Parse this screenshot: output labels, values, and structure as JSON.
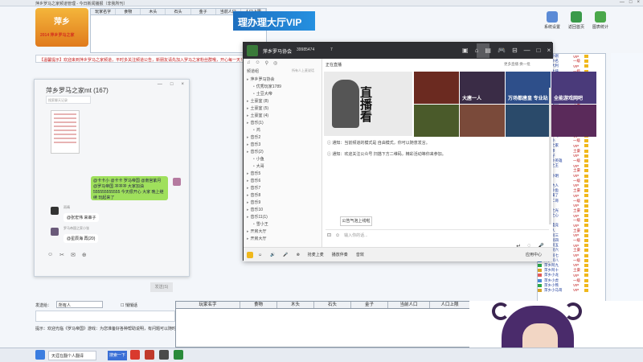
{
  "bg_window": {
    "title": "萍乡罗马之家频道管理 - 今日新闻播报（非我所刊）",
    "controls": [
      "—",
      "□",
      "×"
    ],
    "logo_text": "萍乡",
    "logo_sub": "2014 萍乡罗马之家",
    "vip_banner": "理办理大厅VIP",
    "tools": [
      {
        "label": "系统设置",
        "color": "#5b8bd6"
      },
      {
        "label": "返回首页",
        "color": "#3a9a4a"
      },
      {
        "label": "图表统计",
        "color": "#4aa84a"
      }
    ],
    "announcement": "【温馨提示】欢迎来到萍乡罗马之家频道，平时多关注频道公告，新朋友请先加入罗马之家粉丝群哦，开心每一天！",
    "top_table_headers": [
      "玩家名字",
      "食物",
      "木头",
      "石头",
      "金子",
      "当前人口",
      "人口上限"
    ]
  },
  "chat": {
    "title": "萍乡罗马之家mt (167)",
    "controls": [
      "—",
      "□",
      "×"
    ],
    "search_placeholder": "搜索聊天记录",
    "green_msg": "@卡卡小 @卡卡 罗马帝国 @南宫紫月 @罗马帝国 冲冲冲 大家加油 555555555555 今天很开心 大家 晚上继续 玩起来了",
    "user1_name": "雨晴",
    "user1_msg": "@张宏伟 来串子",
    "user2_name": "罗马帝国之家小张",
    "user2_msg": "@星辰海 再(20)",
    "toolbar": [
      "☺",
      "✂",
      "✉",
      "⊕"
    ],
    "send_label": "发送(S)"
  },
  "yy": {
    "name": "萍乡罗马协会",
    "id": "39985474",
    "fans": "7",
    "head_icons": [
      "▣",
      "⌂",
      "▤",
      "🎮",
      "⊟",
      "—",
      "□",
      "×"
    ],
    "channel_label": "频道组",
    "channel_right": "所有人上麦说话",
    "tabs_top": [
      "♫",
      "☺",
      "⚲",
      "◎"
    ],
    "channels": [
      {
        "label": "萍乡罗马协会",
        "level": 0
      },
      {
        "label": "优秀玩家1789",
        "level": 1
      },
      {
        "label": "土豆大帝",
        "level": 1
      },
      {
        "label": "土豪室 (8)",
        "level": 0
      },
      {
        "label": "土豪室 (5)",
        "level": 0
      },
      {
        "label": "土豪室 (4)",
        "level": 0
      },
      {
        "label": "音乐(1)",
        "level": 0
      },
      {
        "label": "鸿",
        "level": 1
      },
      {
        "label": "音乐2",
        "level": 0
      },
      {
        "label": "音乐3",
        "level": 0
      },
      {
        "label": "音乐(2)",
        "level": 0
      },
      {
        "label": "小鱼",
        "level": 1
      },
      {
        "label": "大哥",
        "level": 1
      },
      {
        "label": "音乐5",
        "level": 0
      },
      {
        "label": "音乐6",
        "level": 0
      },
      {
        "label": "音乐7",
        "level": 0
      },
      {
        "label": "音乐8",
        "level": 0
      },
      {
        "label": "音乐9",
        "level": 0
      },
      {
        "label": "音乐10",
        "level": 0
      },
      {
        "label": "音乐11(1)",
        "level": 0
      },
      {
        "label": "雪小王",
        "level": 1
      },
      {
        "label": "开房大厅",
        "level": 0
      },
      {
        "label": "开房大厅",
        "level": 0
      }
    ],
    "live_tab": "正在直播",
    "live_more": "更多直播    换一批",
    "poster_text": "直播看",
    "thumbs": [
      {
        "label": "",
        "color": "#6b2a20"
      },
      {
        "label": "",
        "color": "#3a2c46"
      },
      {
        "label": "",
        "color": "#2e4f8a"
      },
      {
        "label": "",
        "color": "#4a3a7a"
      },
      {
        "label": "",
        "color": "#4a5a2a"
      },
      {
        "label": "",
        "color": "#7a4a3a"
      },
      {
        "label": "",
        "color": "#2a4a6a"
      },
      {
        "label": "",
        "color": "#5a2a5a"
      }
    ],
    "thumb_titles": [
      "",
      "大唐一人",
      "万场都唐皇 专业站\n",
      "全能游戏网吧\n"
    ],
    "notice1": "通知：当前频道的模式是 自由模式，你可以随意发言。",
    "notice2": "通知：欢迎关注公众号 扫描下方二维码，精彩活动等你来参加。",
    "announce_btn": "公告气泡上线啦",
    "input_placeholder": "输入你的话...",
    "foot": [
      "☺",
      "🔊",
      "🎤",
      "⊗",
      "抢麦上麦",
      "播放伴奏",
      "音效"
    ],
    "foot_right": "应用中心"
  },
  "bottom": {
    "table_headers": [
      "玩家名字",
      "食物",
      "木头",
      "石头",
      "金子",
      "当前人口",
      "人口上限"
    ],
    "status_label": "发送给：",
    "status_select": "所有人",
    "status_check": "悄悄话",
    "status_line": "提示：欢迎光临《罗马帝国》游戏：为您准备好各种帮助说明，有问题可以随时联系管理员（群主）进入频道"
  },
  "user_list": [
    {
      "n": "萍乡小刚",
      "v": "VIP"
    },
    {
      "n": "萍乡小名",
      "v": "一级"
    },
    {
      "n": "大吉大利",
      "v": "VIP"
    },
    {
      "n": "雨晴大侠",
      "v": "一级"
    },
    {
      "n": "萍乡天子",
      "v": "VIP"
    },
    {
      "n": "萍乡王子",
      "v": "土豪"
    },
    {
      "n": "大世界",
      "v": "VIP"
    },
    {
      "n": "萍乡侠",
      "v": "一级"
    },
    {
      "n": "小蜜蜂",
      "v": "土豪"
    },
    {
      "n": "萍乡大哥",
      "v": "一级"
    },
    {
      "n": "罗马帝国",
      "v": "土豪"
    },
    {
      "n": "萍乡小",
      "v": "VIP"
    },
    {
      "n": "萍乡人",
      "v": "VIP"
    },
    {
      "n": "萍乡人家",
      "v": "一级"
    },
    {
      "n": "罗马小卒",
      "v": "土豪"
    },
    {
      "n": "萍乡第一",
      "v": "VIP"
    },
    {
      "n": "萍乡小马",
      "v": "VIP"
    },
    {
      "n": "大大小",
      "v": "一级"
    },
    {
      "n": "罗马之家",
      "v": "VIP"
    },
    {
      "n": "罗马帝",
      "v": "土豪"
    },
    {
      "n": "萍乡仔",
      "v": "VIP"
    },
    {
      "n": "萍乡小英雄",
      "v": "一级"
    },
    {
      "n": "萍乡之王",
      "v": "VIP"
    },
    {
      "n": "萍乡",
      "v": "土豪"
    },
    {
      "n": "萍乡小明",
      "v": "VIP"
    },
    {
      "n": "罗马",
      "v": "一级"
    },
    {
      "n": "萍乡达人",
      "v": "VIP"
    },
    {
      "n": "萍乡小鱼",
      "v": "土豪"
    },
    {
      "n": "萍乡来了",
      "v": "VIP"
    },
    {
      "n": "萍乡二哥",
      "v": "一级"
    },
    {
      "n": "大战",
      "v": "VIP"
    },
    {
      "n": "萍乡之光",
      "v": "土豪"
    },
    {
      "n": "萍乡之心",
      "v": "VIP"
    },
    {
      "n": "萍乡",
      "v": "一级"
    },
    {
      "n": "萍乡电竞",
      "v": "VIP"
    },
    {
      "n": "罗马人",
      "v": "土豪"
    },
    {
      "n": "萍乡阿三",
      "v": "VIP"
    },
    {
      "n": "萍乡阿四",
      "v": "一级"
    },
    {
      "n": "萍乡阿五",
      "v": "VIP"
    },
    {
      "n": "萍乡阿六",
      "v": "土豪"
    },
    {
      "n": "萍乡阿七",
      "v": "VIP"
    },
    {
      "n": "萍乡阿八",
      "v": "一级"
    },
    {
      "n": "萍乡阿九",
      "v": "VIP"
    },
    {
      "n": "萍乡阿十",
      "v": "土豪"
    },
    {
      "n": "萍乡小龙",
      "v": "VIP"
    },
    {
      "n": "萍乡小虎",
      "v": "一级"
    },
    {
      "n": "萍乡小熊",
      "v": "VIP"
    },
    {
      "n": "萍乡小马哥",
      "v": "VIP"
    }
  ],
  "taskbar": {
    "search_text": "天涯在翻个人翻译",
    "btn": "搜索一下"
  },
  "colors": {
    "accent_green": "#9fe05c",
    "dark_header": "#2e2f33",
    "vip_blue": "#1e6fbf",
    "red_text": "#c21c1c"
  }
}
